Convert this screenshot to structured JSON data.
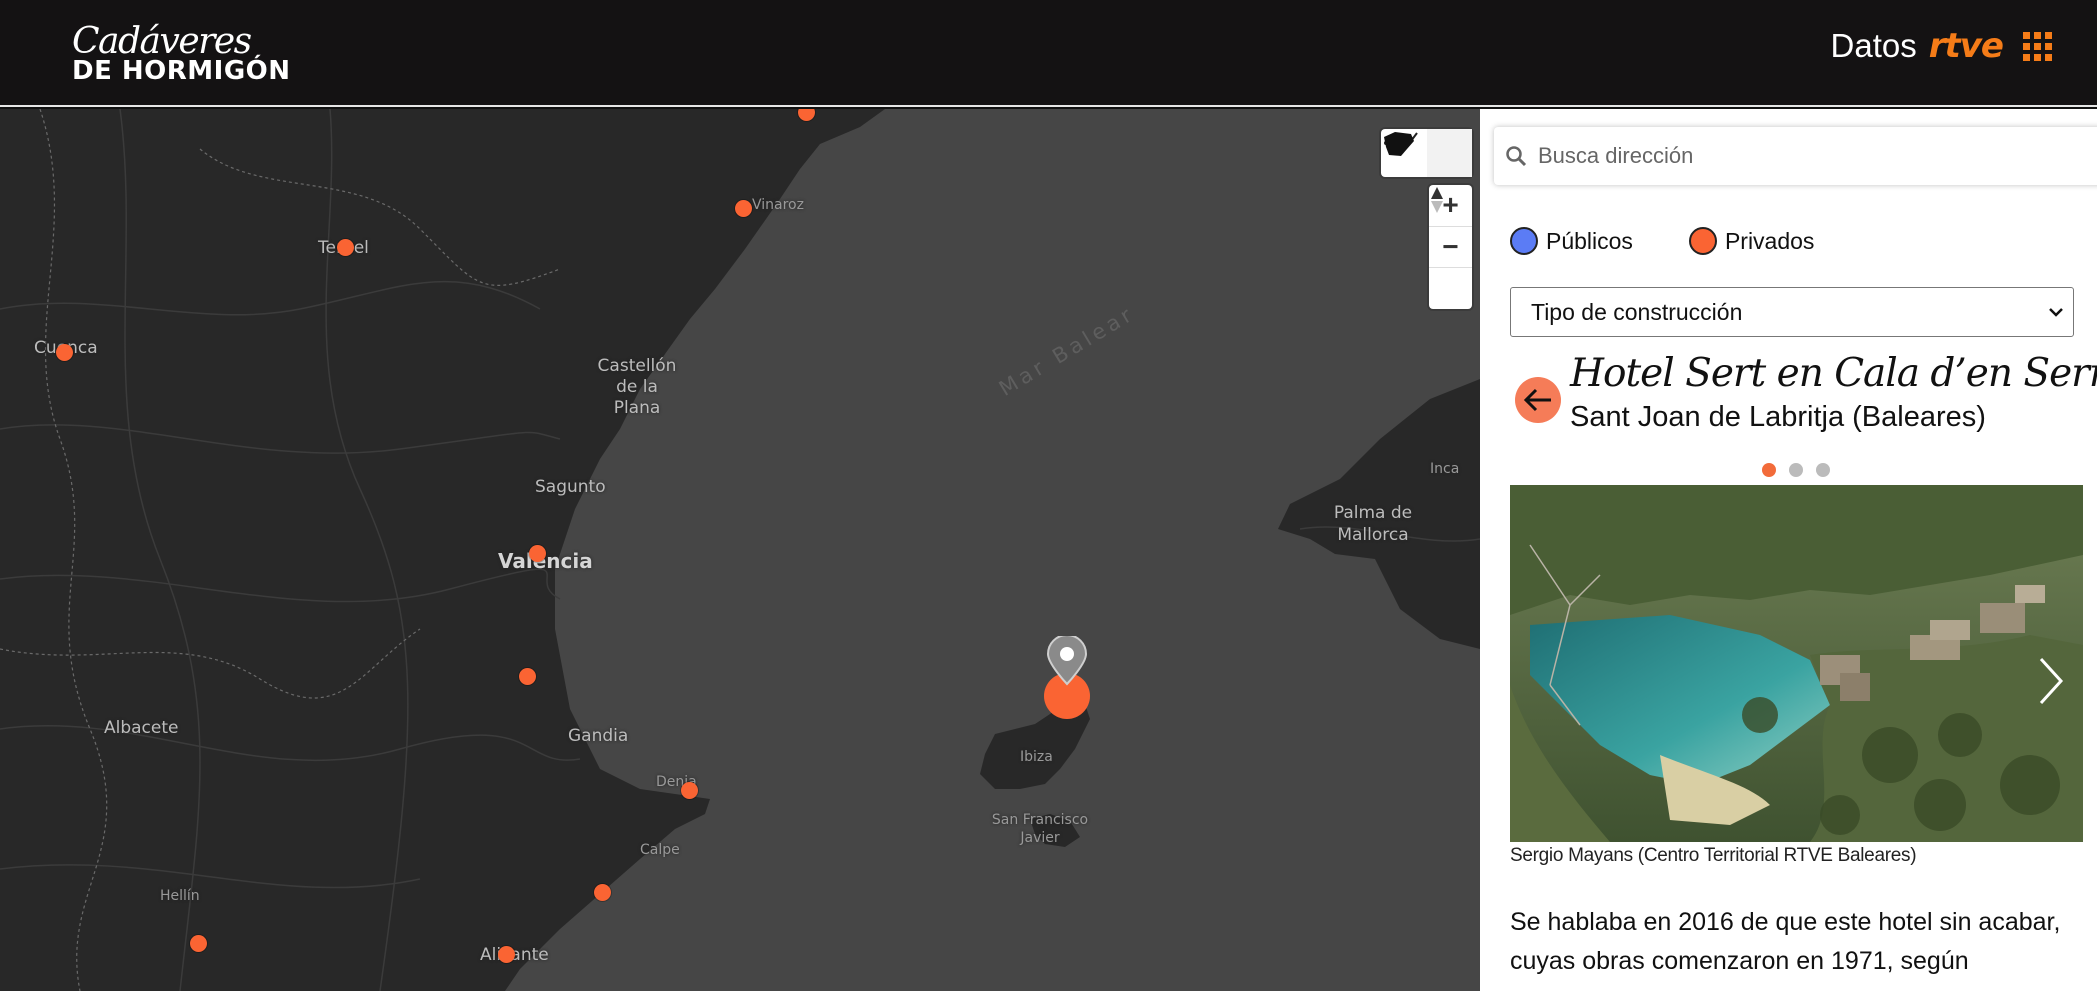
{
  "header": {
    "logo_line1": "Cadáveres",
    "logo_line2": "DE HORMIGÓN",
    "datos": "Datos",
    "rtve": "rtve",
    "menu_icon": "grid-menu-icon"
  },
  "map": {
    "sea_label": "Mar Balear",
    "labels": [
      "Teruel",
      "Vinaroz",
      "Cuenca",
      "Castellón de la Plana",
      "Sagunto",
      "Valencia",
      "Albacete",
      "Gandia",
      "Denia",
      "Calpe",
      "Hellín",
      "Alicante",
      "Palma de Mallorca",
      "Inca",
      "Ibiza",
      "San Francisco Javier"
    ],
    "controls": {
      "zoom_in": "+",
      "zoom_out": "−"
    },
    "marker_colors": {
      "public": "#5b7cf5",
      "private": "#fa6433"
    }
  },
  "panel": {
    "search_placeholder": "Busca dirección",
    "legend": {
      "public_label": "Públicos",
      "private_label": "Privados"
    },
    "select_value": "Tipo de construcción",
    "title": "Hotel Sert en Cala d’en Serra",
    "subtitle": "Sant Joan de Labritja (Baleares)",
    "carousel_total": 3,
    "carousel_active": 1,
    "caption": "Sergio Mayans (Centro Territorial RTVE Baleares)",
    "body": "Se hablaba en 2016 de que este hotel sin acabar, cuyas obras comenzaron en 1971, según"
  }
}
